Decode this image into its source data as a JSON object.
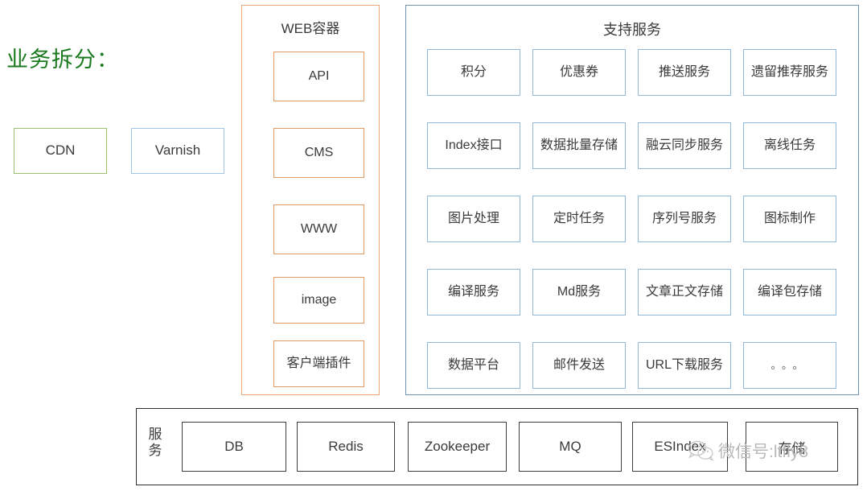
{
  "section": {
    "title": "业务拆分："
  },
  "edge_tier": {
    "items": [
      {
        "label": "CDN",
        "color": "#9cc06f"
      },
      {
        "label": "Varnish",
        "color": "#9fc5e8"
      }
    ]
  },
  "web_container": {
    "title": "WEB容器",
    "border_color": "#e8a87c",
    "items": [
      {
        "label": "API"
      },
      {
        "label": "CMS"
      },
      {
        "label": "WWW"
      },
      {
        "label": "image"
      },
      {
        "label": "客户端插件"
      }
    ]
  },
  "support_services": {
    "title": "支持服务",
    "border_color": "#6b93b5",
    "item_border_color": "#8fb8da",
    "items": [
      {
        "label": "积分"
      },
      {
        "label": "优惠券"
      },
      {
        "label": "推送服务"
      },
      {
        "label": "遗留推荐服务"
      },
      {
        "label": "Index接口"
      },
      {
        "label": "数据批量存储"
      },
      {
        "label": "融云同步服务"
      },
      {
        "label": "离线任务"
      },
      {
        "label": "图片处理"
      },
      {
        "label": "定时任务"
      },
      {
        "label": "序列号服务"
      },
      {
        "label": "图标制作"
      },
      {
        "label": "编译服务"
      },
      {
        "label": "Md服务"
      },
      {
        "label": "文章正文存储"
      },
      {
        "label": "编译包存储"
      },
      {
        "label": "数据平台"
      },
      {
        "label": "邮件发送"
      },
      {
        "label": "URL下载服务"
      },
      {
        "label": "。。。"
      }
    ]
  },
  "infrastructure": {
    "label": "服务",
    "border_color": "#2f2f2f",
    "items": [
      {
        "label": "DB"
      },
      {
        "label": "Redis"
      },
      {
        "label": "Zookeeper"
      },
      {
        "label": "MQ"
      },
      {
        "label": "ESIndex"
      },
      {
        "label": "存储"
      }
    ]
  },
  "watermark": {
    "text": "微信号:ltfly8",
    "color": "#b9b9b9"
  }
}
